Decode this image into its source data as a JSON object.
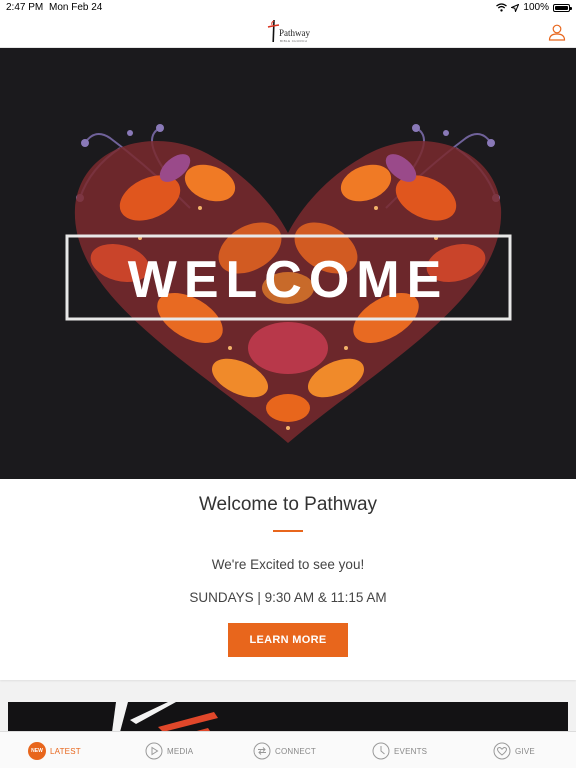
{
  "status_bar": {
    "time": "2:47 PM",
    "date": "Mon Feb 24",
    "battery": "100%"
  },
  "nav": {
    "logo_name": "Pathway",
    "logo_sub": "BIBLE CHURCH"
  },
  "hero": {
    "banner_text": "WELCOME"
  },
  "welcome_card": {
    "title": "Welcome to Pathway",
    "subtitle": "We're Excited to see you!",
    "service_times": "SUNDAYS | 9:30 AM & 11:15 AM",
    "button_label": "LEARN MORE"
  },
  "tabs": [
    {
      "label": "LATEST",
      "icon": "new-badge",
      "badge": "NEW",
      "active": true
    },
    {
      "label": "MEDIA",
      "icon": "play-icon",
      "active": false
    },
    {
      "label": "CONNECT",
      "icon": "connect-icon",
      "active": false
    },
    {
      "label": "EVENTS",
      "icon": "clock-icon",
      "active": false
    },
    {
      "label": "GIVE",
      "icon": "heart-icon",
      "active": false
    }
  ],
  "colors": {
    "accent": "#e8661c",
    "hero_background": "#1b1a1d",
    "tab_inactive": "#888888"
  }
}
